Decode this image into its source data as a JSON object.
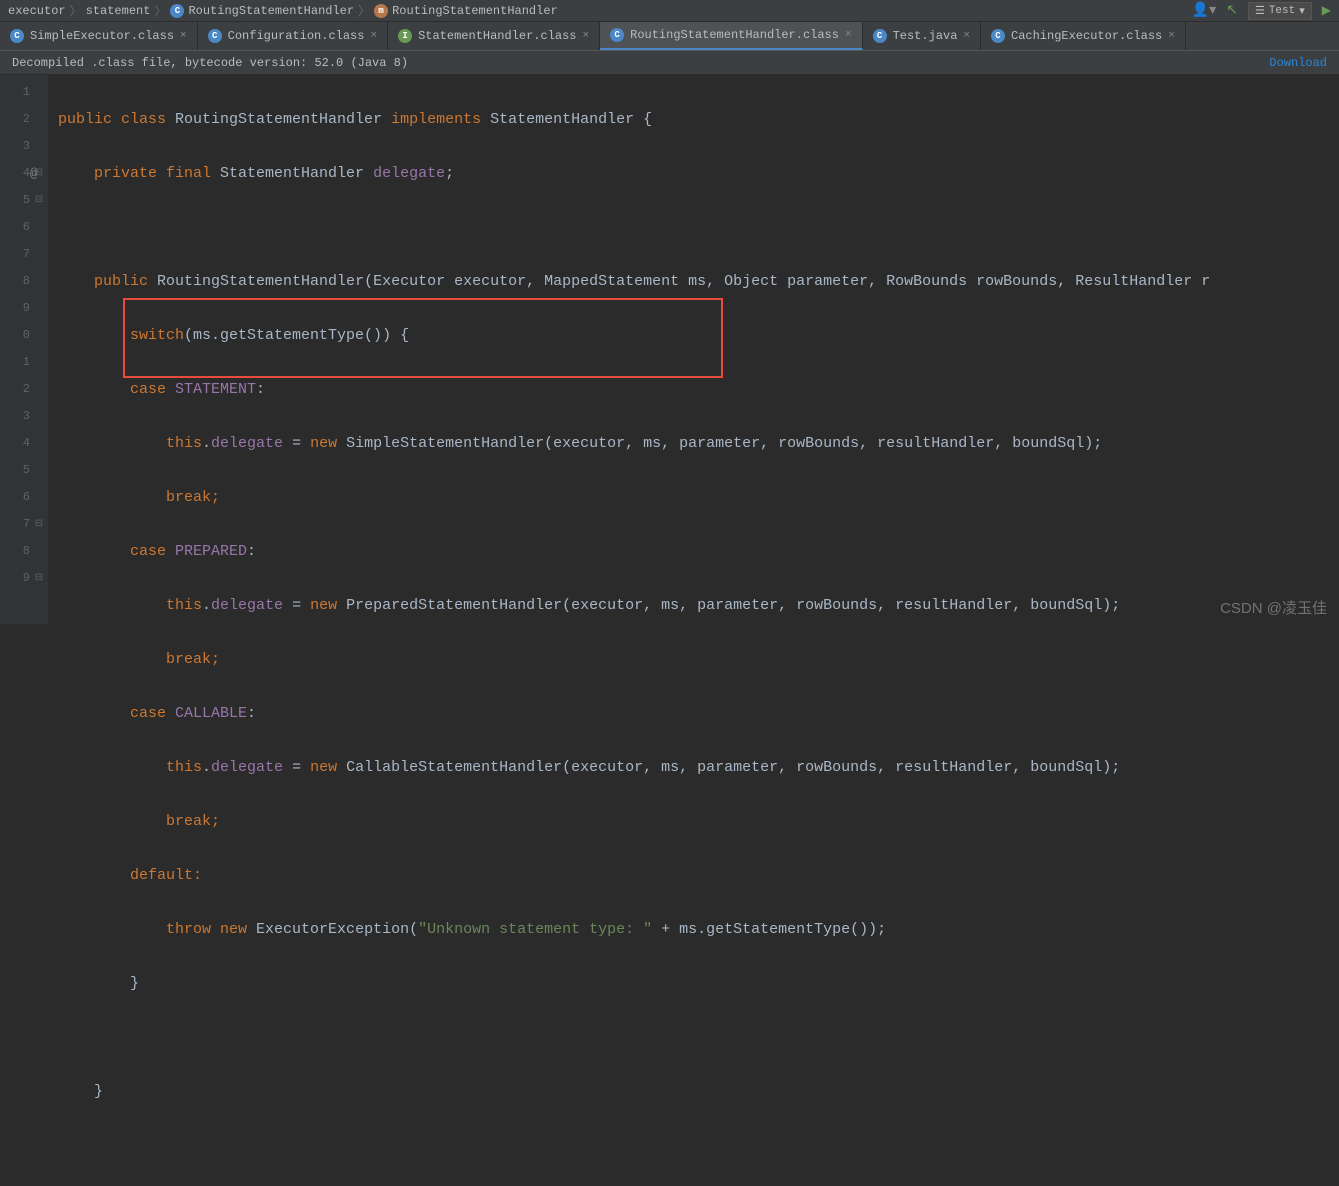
{
  "breadcrumb": {
    "items": [
      "executor",
      "statement",
      "RoutingStatementHandler",
      "RoutingStatementHandler"
    ]
  },
  "run_config": "Test",
  "tabs": [
    {
      "label": "SimpleExecutor.class",
      "active": false,
      "icon": "blue"
    },
    {
      "label": "Configuration.class",
      "active": false,
      "icon": "blue"
    },
    {
      "label": "StatementHandler.class",
      "active": false,
      "icon": "green"
    },
    {
      "label": "RoutingStatementHandler.class",
      "active": true,
      "icon": "blue"
    },
    {
      "label": "Test.java",
      "active": false,
      "icon": "blue"
    },
    {
      "label": "CachingExecutor.class",
      "active": false,
      "icon": "blue"
    }
  ],
  "banner": {
    "text": "Decompiled .class file, bytecode version: 52.0 (Java 8)",
    "link": "Download"
  },
  "line_numbers": [
    "1",
    "2",
    "3",
    "4",
    "5",
    "6",
    "7",
    "8",
    "9",
    "0",
    "1",
    "2",
    "3",
    "4",
    "5",
    "6",
    "7",
    "8",
    "9"
  ],
  "code": {
    "l1a": "public class ",
    "l1b": "RoutingStatementHandler ",
    "l1c": "implements ",
    "l1d": "StatementHandler {",
    "l2a": "    private final ",
    "l2b": "StatementHandler ",
    "l2c": "delegate",
    "l2d": ";",
    "l4a": "    public ",
    "l4b": "RoutingStatementHandler",
    "l4c": "(Executor executor, MappedStatement ms, Object parameter, RowBounds rowBounds, ResultHandler r",
    "l5a": "        switch",
    "l5b": "(ms.getStatementType()) {",
    "l6a": "        case ",
    "l6b": "STATEMENT",
    "l6c": ":",
    "l7a": "            this",
    "l7b": ".",
    "l7c": "delegate ",
    "l7d": "= ",
    "l7e": "new ",
    "l7f": "SimpleStatementHandler(executor, ms, parameter, rowBounds, resultHandler, boundSql);",
    "l8a": "            break;",
    "l9a": "        case ",
    "l9b": "PREPARED",
    "l9c": ":",
    "l10a": "            this",
    "l10b": ".",
    "l10c": "delegate ",
    "l10d": "= ",
    "l10e": "new ",
    "l10f": "PreparedStatementHandler(executor, ms, parameter, rowBounds, resultHandler, boundSql);",
    "l11a": "            break;",
    "l12a": "        case ",
    "l12b": "CALLABLE",
    "l12c": ":",
    "l13a": "            this",
    "l13b": ".",
    "l13c": "delegate ",
    "l13d": "= ",
    "l13e": "new ",
    "l13f": "CallableStatementHandler(executor, ms, parameter, rowBounds, resultHandler, boundSql);",
    "l14a": "            break;",
    "l15a": "        default:",
    "l16a": "            throw new ",
    "l16b": "ExecutorException(",
    "l16c": "\"Unknown statement type: \" ",
    "l16d": "+ ms.getStatementType());",
    "l17a": "        }",
    "l19a": "    }"
  },
  "watermark": "CSDN @凌玉佳"
}
